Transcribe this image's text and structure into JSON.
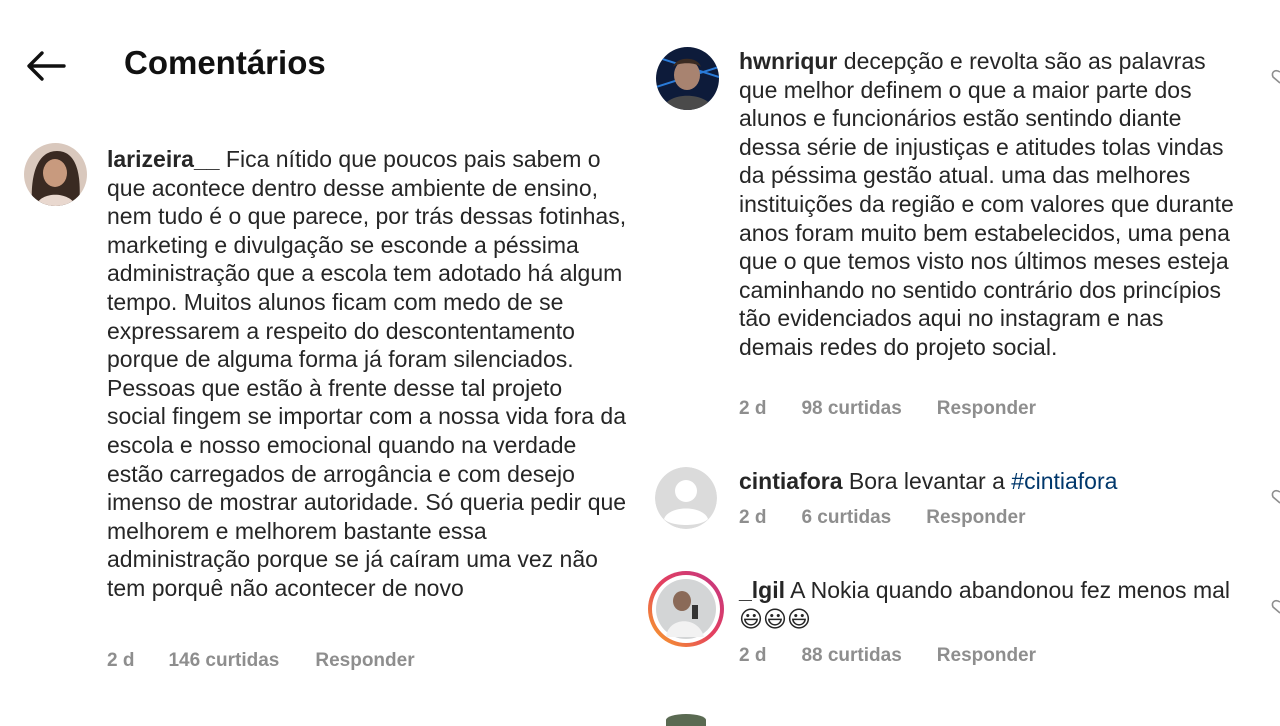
{
  "header": {
    "title": "Comentários",
    "back_icon": "arrow-left-icon"
  },
  "comments": [
    {
      "user": "larizeira__",
      "text": "Fica nítido que poucos pais sabem o que acontece dentro desse ambiente de ensino, nem tudo é o que parece, por trás dessas fotinhas, marketing e divulgação se esconde a péssima administração que a escola tem adotado há algum tempo. Muitos alunos ficam com medo de se expressarem a respeito do descontentamento porque de alguma forma já foram silenciados. Pessoas que estão à frente desse tal projeto social fingem se importar com a nossa vida fora da escola e nosso emocional quando na verdade estão carregados de arrogância e com desejo imenso de mostrar autoridade. Só queria pedir que melhorem e melhorem bastante essa administração porque se já caíram uma vez não tem porquê não acontecer de novo",
      "time": "2 d",
      "likes": "146 curtidas",
      "reply": "Responder"
    },
    {
      "user": "hwnriqur",
      "text": "decepção e revolta são as palavras que melhor definem o que a maior parte dos alunos e funcionários estão sentindo diante dessa série de injustiças e atitudes tolas vindas da péssima gestão atual. uma das melhores instituições da região e com valores que durante anos foram muito bem estabelecidos, uma pena que o que temos visto nos últimos meses esteja caminhando no sentido contrário dos princípios tão evidenciados aqui no instagram e nas demais redes do projeto social.",
      "time": "2 d",
      "likes": "98 curtidas",
      "reply": "Responder"
    },
    {
      "user": "cintiafora",
      "text": "Bora levantar a",
      "hashtag": "#cintiafora",
      "time": "2 d",
      "likes": "6 curtidas",
      "reply": "Responder"
    },
    {
      "user": "_lgil",
      "text": "A Nokia quando abandonou fez menos mal😃😃😃",
      "time": "2 d",
      "likes": "88 curtidas",
      "reply": "Responder"
    }
  ],
  "icons": {
    "like": "heart-outline-icon"
  },
  "colors": {
    "text": "#262626",
    "meta": "#8e8e8e",
    "hashtag": "#00376b",
    "story_ring": "#e4405f"
  }
}
